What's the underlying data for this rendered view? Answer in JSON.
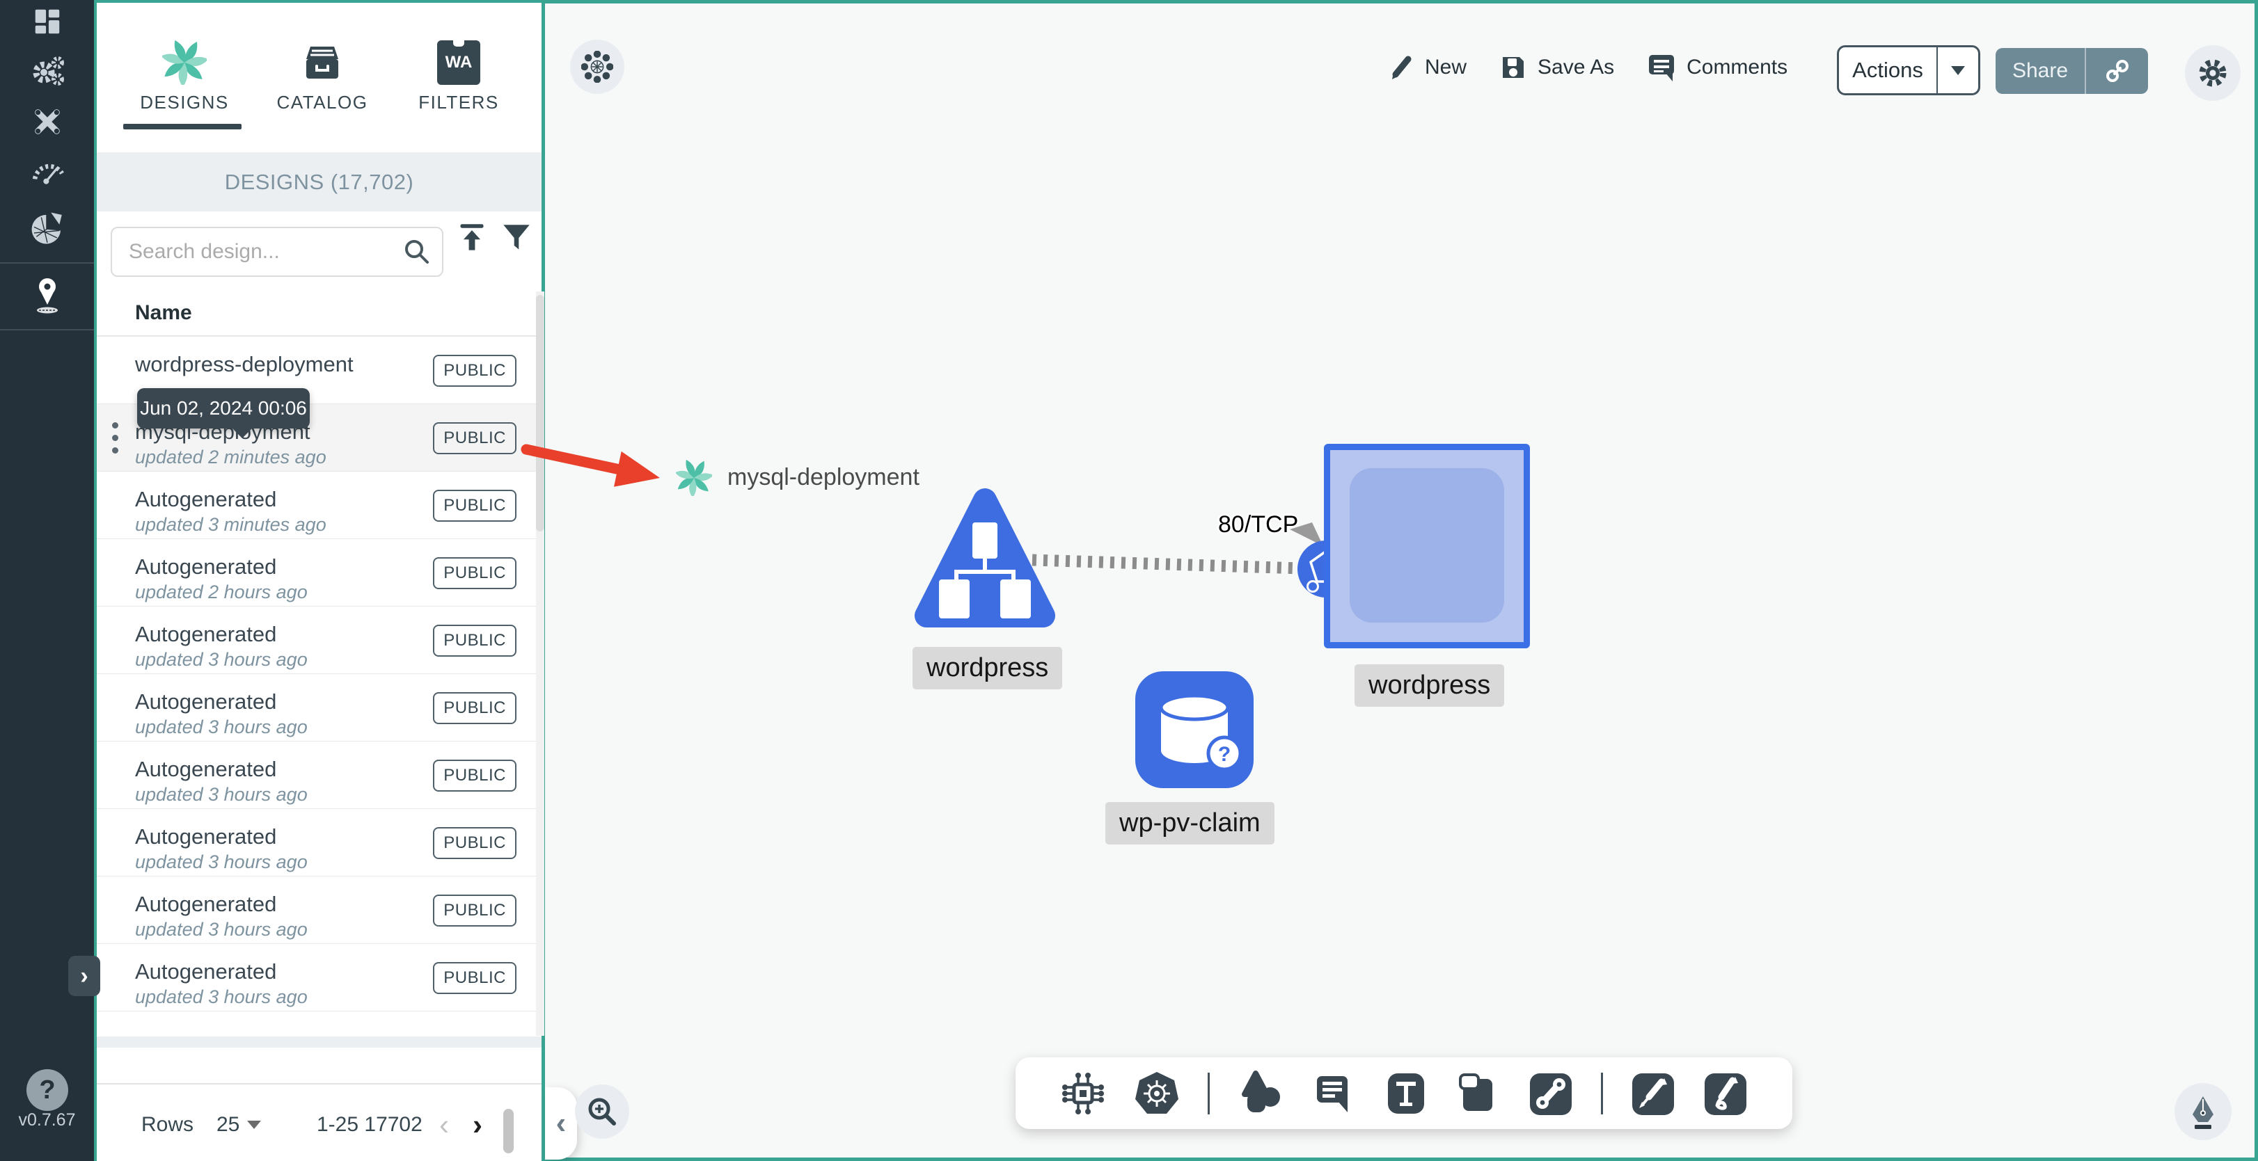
{
  "app": {
    "version": "v0.7.67"
  },
  "colors": {
    "sidebar_bg": "#24303A",
    "teal": "#3AA493",
    "slate": "#37474F",
    "node_blue": "#3D6DE0",
    "share_bg": "#6F8A97",
    "canvas_bg": "#F7F8F8",
    "red_arrow": "#E8402A"
  },
  "sidebar": {
    "items": [
      {
        "id": "dashboard"
      },
      {
        "id": "lifecycle"
      },
      {
        "id": "configuration"
      },
      {
        "id": "performance"
      },
      {
        "id": "extensions"
      },
      {
        "id": "kanvas",
        "active": true
      }
    ],
    "help": "?"
  },
  "tabs": {
    "designs": {
      "label": "DESIGNS",
      "active": true
    },
    "catalog": {
      "label": "CATALOG"
    },
    "filters": {
      "label": "FILTERS",
      "badge": "WA"
    }
  },
  "panel": {
    "header": "DESIGNS (17,702)",
    "search": {
      "placeholder": "Search design..."
    },
    "columns": {
      "name": "Name"
    },
    "tooltip": "Jun 02, 2024 00:06",
    "rows": [
      {
        "name": "wordpress-deployment",
        "updated": "",
        "badge": "PUBLIC"
      },
      {
        "name": "mysql-deployment",
        "updated": "updated 2 minutes ago",
        "badge": "PUBLIC",
        "highlighted": true,
        "menu": true
      },
      {
        "name": "Autogenerated",
        "updated": "updated 3 minutes ago",
        "badge": "PUBLIC"
      },
      {
        "name": "Autogenerated",
        "updated": "updated 2 hours ago",
        "badge": "PUBLIC"
      },
      {
        "name": "Autogenerated",
        "updated": "updated 3 hours ago",
        "badge": "PUBLIC"
      },
      {
        "name": "Autogenerated",
        "updated": "updated 3 hours ago",
        "badge": "PUBLIC"
      },
      {
        "name": "Autogenerated",
        "updated": "updated 3 hours ago",
        "badge": "PUBLIC"
      },
      {
        "name": "Autogenerated",
        "updated": "updated 3 hours ago",
        "badge": "PUBLIC"
      },
      {
        "name": "Autogenerated",
        "updated": "updated 3 hours ago",
        "badge": "PUBLIC"
      },
      {
        "name": "Autogenerated",
        "updated": "updated 3 hours ago",
        "badge": "PUBLIC"
      }
    ],
    "footer": {
      "rows_label": "Rows",
      "per_page": "25",
      "range": "1-25 17702",
      "prev": "‹",
      "next": "›"
    }
  },
  "topbar": {
    "new": "New",
    "save_as": "Save As",
    "comments": "Comments",
    "actions": "Actions",
    "share": "Share"
  },
  "canvas": {
    "nodes": {
      "mysql": {
        "label": "mysql-deployment"
      },
      "service": {
        "label": "wordpress"
      },
      "deployment": {
        "label": "wordpress"
      },
      "pvc": {
        "label": "wp-pv-claim"
      }
    },
    "edge": {
      "label": "80/TCP"
    }
  }
}
